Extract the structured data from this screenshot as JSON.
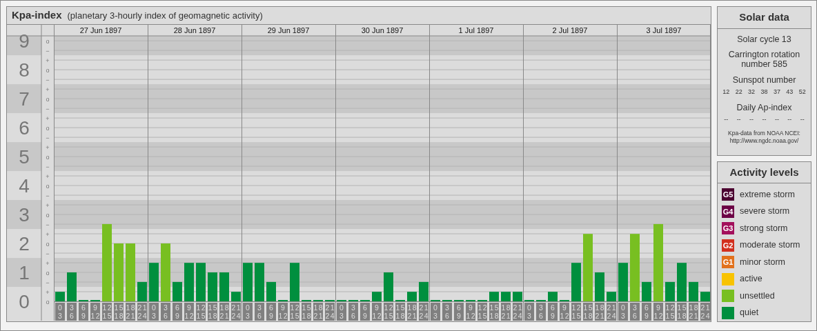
{
  "kp_panel": {
    "title": "Kpa-index",
    "subtitle": "(planetary 3-hourly index of geomagnetic activity)",
    "days": [
      "27 Jun 1897",
      "28 Jun 1897",
      "29 Jun 1897",
      "30 Jun 1897",
      "1 Jul 1897",
      "2 Jul 1897",
      "3 Jul 1897"
    ],
    "scale_marks": [
      [
        "o",
        "−"
      ],
      [
        "+",
        "o",
        "−"
      ],
      [
        "+",
        "o",
        "−"
      ],
      [
        "+",
        "o",
        "−"
      ],
      [
        "+",
        "o",
        "−"
      ],
      [
        "+",
        "o",
        "−"
      ],
      [
        "+",
        "o",
        "−"
      ],
      [
        "+",
        "o",
        "−"
      ],
      [
        "+",
        "o",
        "−"
      ],
      [
        "+",
        "o"
      ]
    ],
    "chart_data": {
      "type": "bar",
      "grid": true,
      "ylim": [
        0,
        9.17
      ],
      "yticks": [
        0,
        1,
        2,
        3,
        4,
        5,
        6,
        7,
        8,
        9
      ],
      "categories": [
        "0 3",
        "3 6",
        "6 9",
        "9 12",
        "12 15",
        "15 18",
        "18 21",
        "21 24",
        "0 3",
        "3 6",
        "6 9",
        "9 12",
        "12 15",
        "15 18",
        "18 21",
        "21 24",
        "0 3",
        "3 6",
        "6 9",
        "9 12",
        "12 15",
        "15 18",
        "18 21",
        "21 24",
        "0 3",
        "3 6",
        "6 9",
        "9 12",
        "12 15",
        "15 18",
        "18 21",
        "21 24",
        "0 3",
        "3 6",
        "6 9",
        "9 12",
        "12 15",
        "15 18",
        "18 21",
        "21 24",
        "0 3",
        "3 6",
        "6 9",
        "9 12",
        "12 15",
        "15 18",
        "18 21",
        "21 24",
        "0 3",
        "3 6",
        "6 9",
        "9 12",
        "12 15",
        "15 18",
        "18 21",
        "21 24"
      ],
      "series": [
        {
          "color": "#008f3e",
          "values": [
            0.33,
            1,
            0,
            0,
            null,
            null,
            null,
            0.67,
            1.33,
            null,
            0.67,
            1.33,
            1.33,
            1,
            1,
            0.33,
            1.33,
            1.33,
            0.67,
            0,
            1.33,
            0,
            0,
            0,
            0,
            0,
            0,
            0.33,
            1,
            0,
            0.33,
            0.67,
            0,
            0,
            0,
            0,
            0,
            0.33,
            0.33,
            0.33,
            0,
            0,
            0.33,
            0,
            1.33,
            null,
            1,
            0.33,
            1.33,
            null,
            0.67,
            null,
            0.67,
            1.33,
            0.67,
            0.33
          ]
        },
        {
          "color": "#78bf21",
          "values": [
            null,
            null,
            null,
            null,
            2.67,
            2,
            2,
            null,
            null,
            2,
            null,
            null,
            null,
            null,
            null,
            null,
            null,
            null,
            null,
            null,
            null,
            null,
            null,
            null,
            null,
            null,
            null,
            null,
            null,
            null,
            null,
            null,
            null,
            null,
            null,
            null,
            null,
            null,
            null,
            null,
            null,
            null,
            null,
            null,
            null,
            2.33,
            null,
            null,
            null,
            2.33,
            null,
            2.67,
            null,
            null,
            null,
            null
          ]
        }
      ]
    }
  },
  "solar_data": {
    "title": "Solar data",
    "solar_cycle": "Solar cycle 13",
    "carrington": "Carrington rotation number 585",
    "sunspot_label": "Sunspot number",
    "sunspot_numbers": [
      "12",
      "22",
      "32",
      "38",
      "37",
      "43",
      "52"
    ],
    "ap_label": "Daily Ap-index",
    "ap_values": [
      "--",
      "--",
      "--",
      "--",
      "--",
      "--",
      "--"
    ],
    "source": "Kpa-data from NOAA NCEI:",
    "source_url": "http://www.ngdc.noaa.gov/"
  },
  "activity_levels": {
    "title": "Activity levels",
    "items": [
      {
        "badge": "G5",
        "label": "extreme storm",
        "color": "#4b0030"
      },
      {
        "badge": "G4",
        "label": "severe storm",
        "color": "#6c0045"
      },
      {
        "badge": "G3",
        "label": "strong storm",
        "color": "#a3105c"
      },
      {
        "badge": "G2",
        "label": "moderate storm",
        "color": "#d2301e"
      },
      {
        "badge": "G1",
        "label": "minor storm",
        "color": "#e2711c"
      },
      {
        "label": "active",
        "color": "#f8c300"
      },
      {
        "label": "unsettled",
        "color": "#78bf21"
      },
      {
        "label": "quiet",
        "color": "#008f3e"
      }
    ]
  }
}
